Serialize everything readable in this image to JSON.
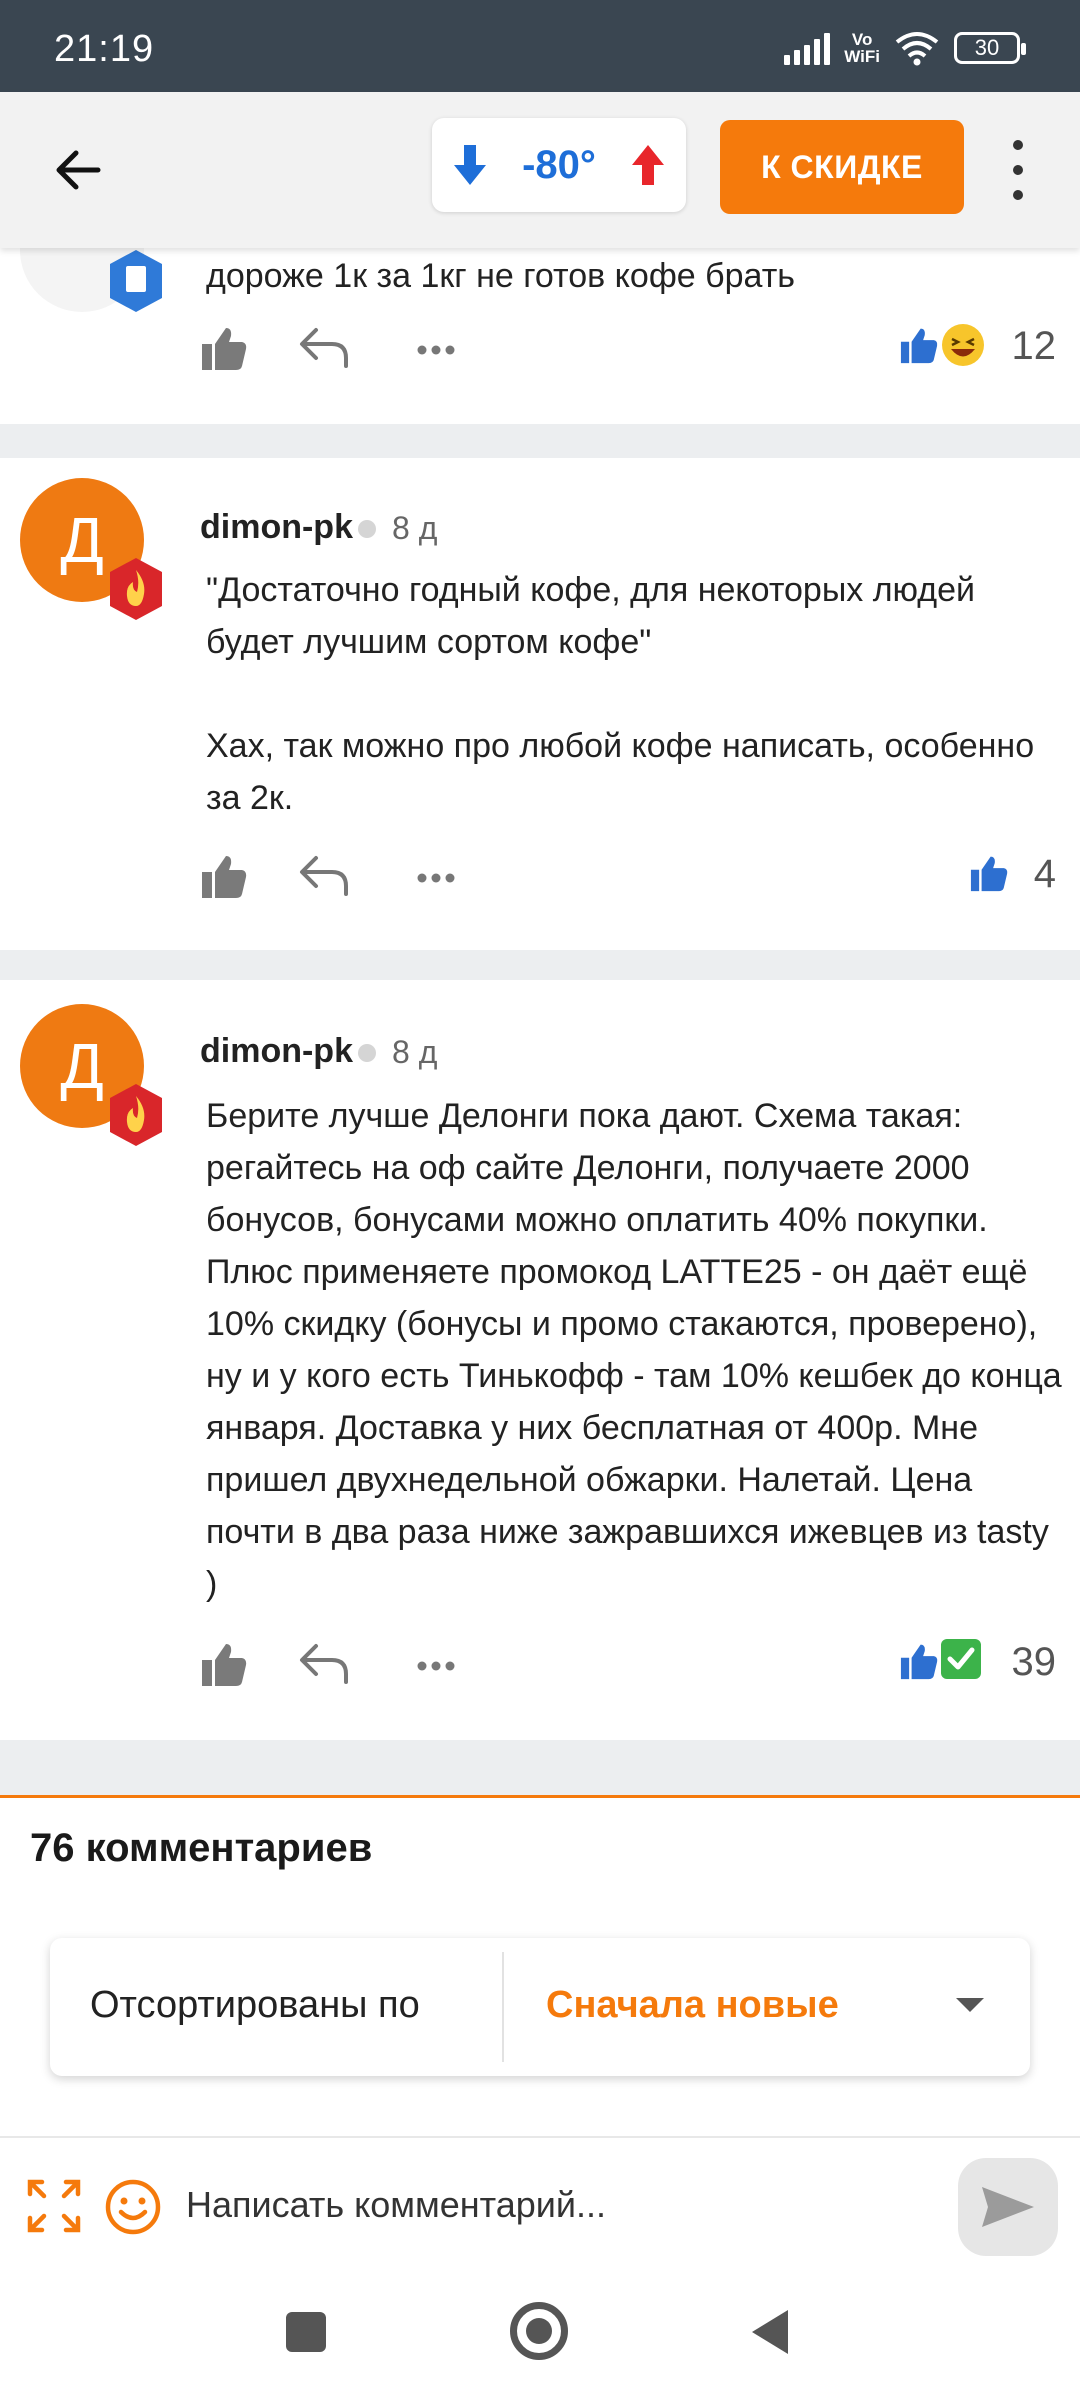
{
  "status": {
    "time": "21:19",
    "vowifi_top": "Vo",
    "vowifi_bottom": "WiFi",
    "battery": "30"
  },
  "header": {
    "temperature": "-80°",
    "deal_button": "К СКИДКЕ"
  },
  "comments": [
    {
      "text": "дороже 1к за 1кг не готов кофе брать",
      "score": "12"
    },
    {
      "avatar_letter": "Д",
      "author": "dimon-pk",
      "age": "8 д",
      "text": "\"Достаточно годный кофе, для некоторых людей будет лучшим сортом кофе\"\n\nХах, так можно про любой кофе написать, особенно за 2к.",
      "score": "4"
    },
    {
      "avatar_letter": "Д",
      "author": "dimon-pk",
      "age": "8 д",
      "text": "Берите лучше Делонги пока дают. Схема такая: регайтесь на оф сайте Делонги, получаете 2000 бонусов, бонусами можно оплатить 40% покупки. Плюс применяете промокод LATTE25 - он даёт ещё 10% скидку (бонусы и промо стакаются, проверено), ну и у кого есть Тинькофф - там 10% кешбек до конца января. Доставка у них бесплатная от 400р. Мне пришел двухнедельной обжарки. Налетай. Цена почти в два раза ниже зажравшихся ижевцев из tasty )",
      "score": "39"
    }
  ],
  "comments_count": "76 комментариев",
  "sort": {
    "label": "Отсортированы по",
    "value": "Сначала новые"
  },
  "composer": {
    "placeholder": "Написать комментарий..."
  },
  "colors": {
    "accent": "#f57a0c",
    "blue": "#1e6ed8",
    "statusbar": "#3a4651"
  },
  "icons": [
    "back-arrow-icon",
    "thumb-down-icon",
    "thumb-up-icon",
    "like-icon",
    "reply-icon",
    "more-icon",
    "laugh-emoji-icon",
    "check-emoji-icon",
    "flame-badge-icon",
    "shield-badge-icon",
    "expand-icon",
    "smile-icon",
    "send-icon"
  ]
}
